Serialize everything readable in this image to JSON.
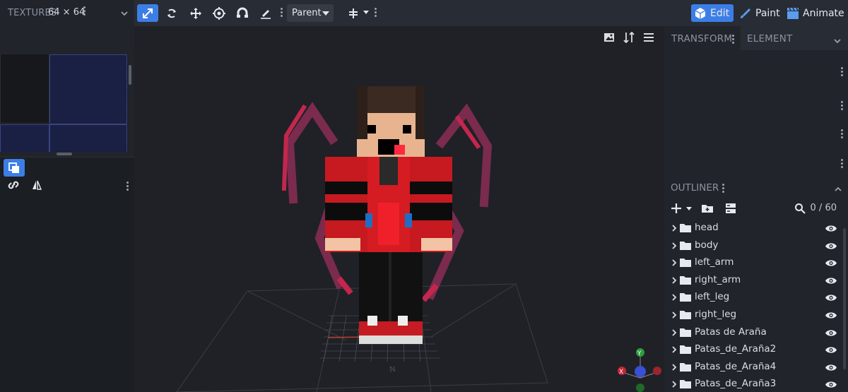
{
  "textures_panel": {
    "title": "TEXTURES",
    "size": "64 × 64"
  },
  "toolbar": {
    "transform_space": "Parent",
    "modes": {
      "edit": "Edit",
      "paint": "Paint",
      "animate": "Animate"
    },
    "colors": {
      "accent": "#3d7ee6",
      "background": "#282c34"
    }
  },
  "right_panel": {
    "tabs": {
      "transform": "TRANSFORM",
      "element": "ELEMENT"
    },
    "outliner": {
      "title": "OUTLINER",
      "count": "0 / 60",
      "items": [
        {
          "label": "head"
        },
        {
          "label": "body"
        },
        {
          "label": "left_arm"
        },
        {
          "label": "right_arm"
        },
        {
          "label": "left_leg"
        },
        {
          "label": "right_leg"
        },
        {
          "label": "Patas de Araña"
        },
        {
          "label": "Patas_de_Araña2"
        },
        {
          "label": "Patas_de_Araña4"
        },
        {
          "label": "Patas_de_Araña3"
        }
      ]
    }
  },
  "icons": [
    "move-tool-icon",
    "rotate-tool-icon",
    "resize-tool-icon",
    "pivot-tool-icon",
    "vertex-snap-icon",
    "paint-brush-icon",
    "cube-icon",
    "film-icon",
    "search-icon",
    "eye-icon",
    "folder-icon",
    "link-icon",
    "mirror-icon",
    "image-icon",
    "sort-icon",
    "menu-icon"
  ]
}
